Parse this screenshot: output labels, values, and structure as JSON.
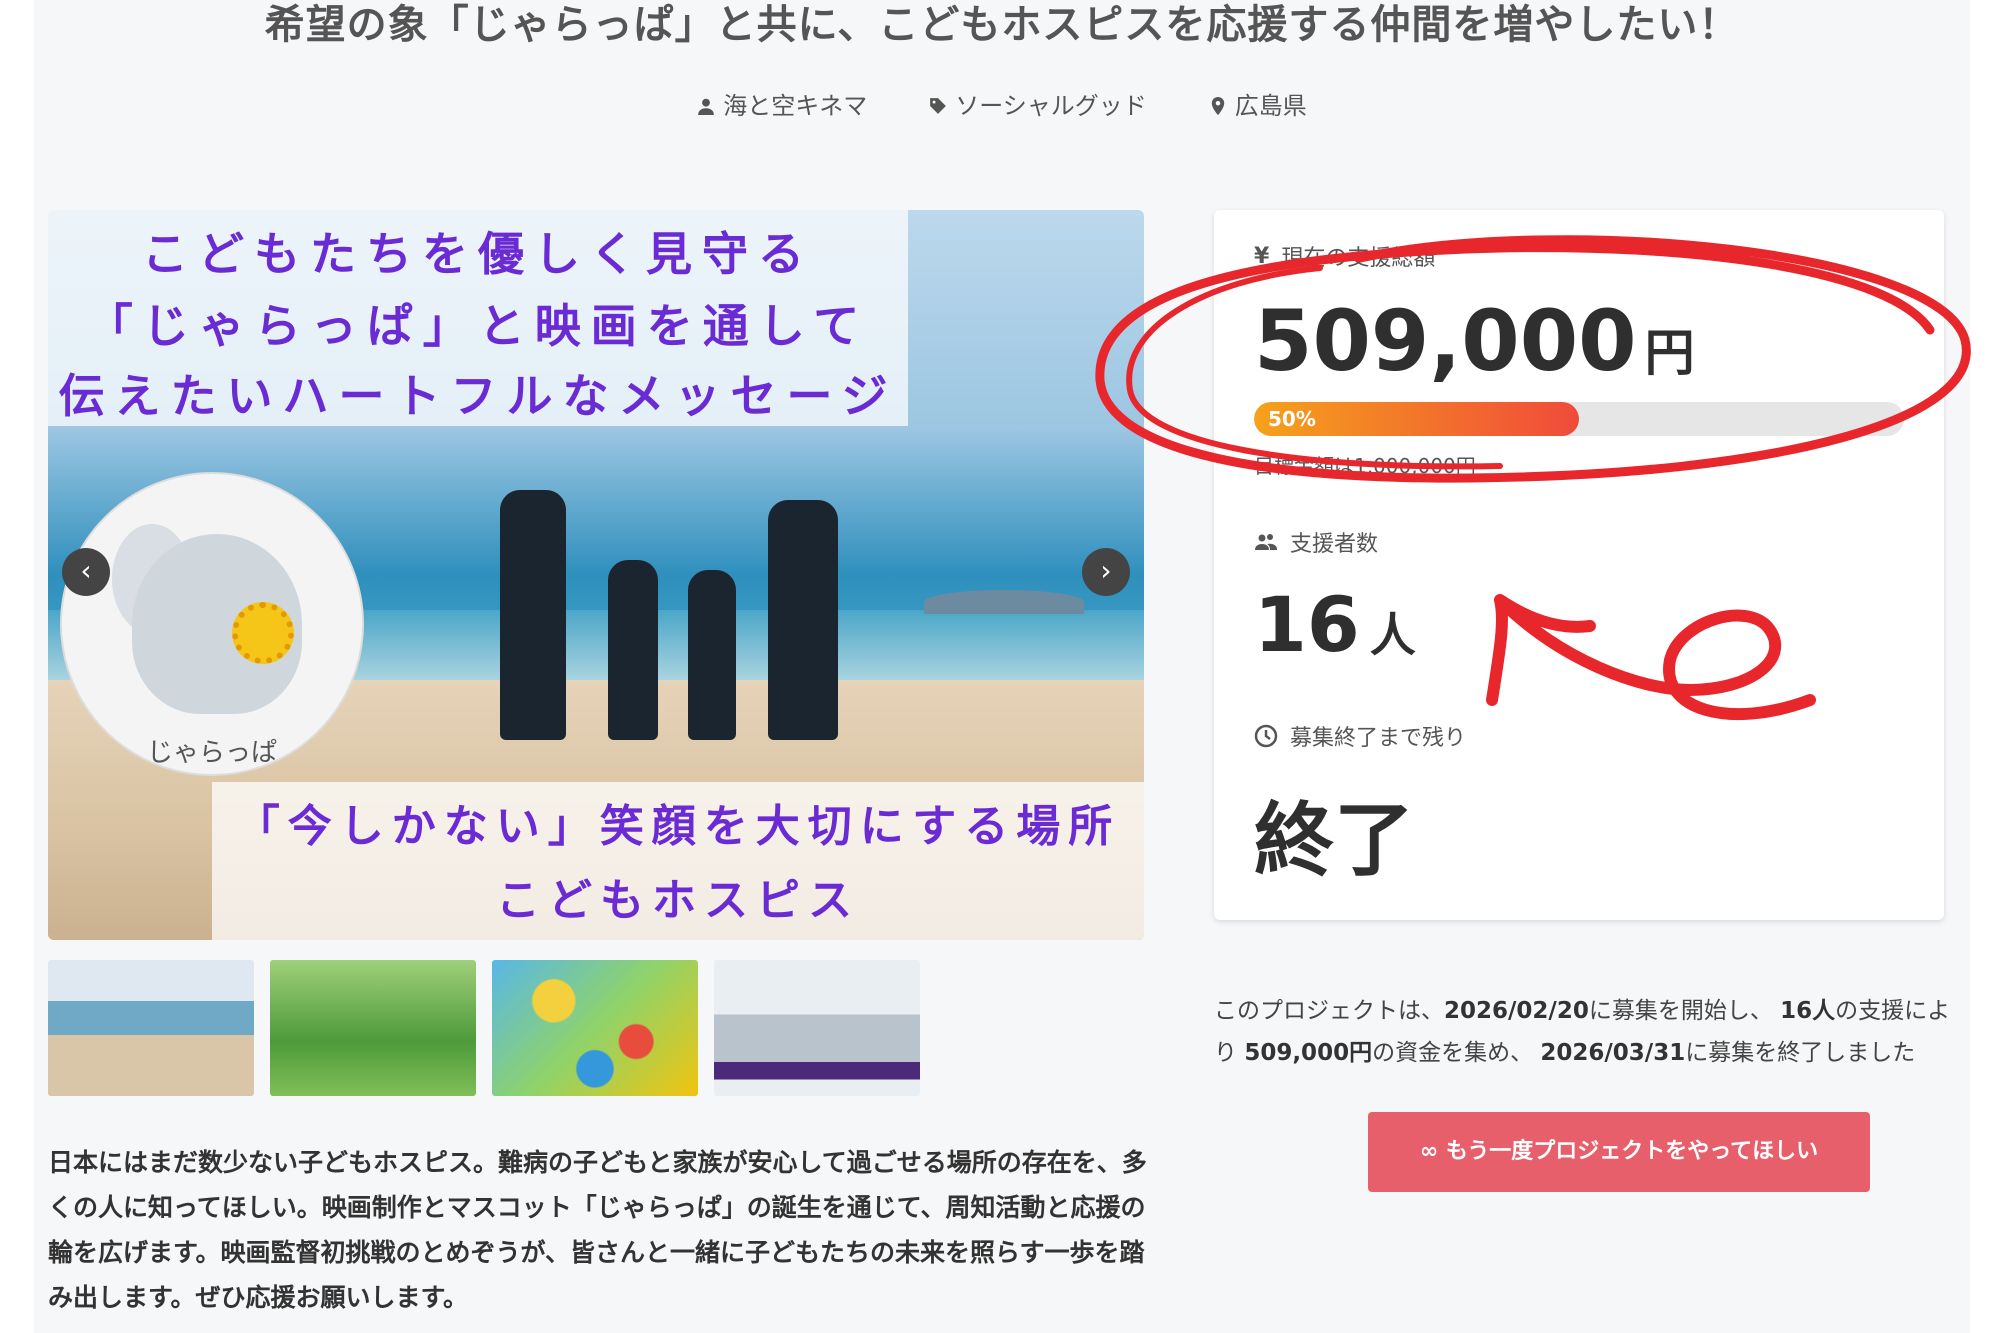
{
  "title": "希望の象「じゃらっぱ」と共に、こどもホスピスを応援する仲間を増やしたい！",
  "meta": {
    "author": "海と空キネマ",
    "category": "ソーシャルグッド",
    "location": "広島県"
  },
  "hero": {
    "lines_top": [
      "こどもたちを優しく見守る",
      "「じゃらっぱ」と映画を通して",
      "伝えたいハートフルなメッセージ"
    ],
    "lines_bottom": [
      "「今しかない」笑顔を大切にする場所",
      "こどもホスピス"
    ],
    "mascot_label": "じゃらっぱ",
    "prev": "‹",
    "next": "›"
  },
  "description": "日本にはまだ数少ない子どもホスピス。難病の子どもと家族が安心して過ごせる場所の存在を、多くの人に知ってほしい。映画制作とマスコット「じゃらっぱ」の誕生を通じて、周知活動と応援の輪を広げます。映画監督初挑戦のとめぞうが、皆さんと一緒に子どもたちの未来を照らす一歩を踏み出します。ぜひ応援お願いします。",
  "stats": {
    "amount_label": "現在の支援総額",
    "amount_value": "509,000",
    "amount_unit": "円",
    "progress_percent": 50,
    "progress_label": "50%",
    "target_text": "目標金額は1,000,000円",
    "backers_label": "支援者数",
    "backers_value": "16",
    "backers_unit": "人",
    "remaining_label": "募集終了まで残り",
    "remaining_value": "終了"
  },
  "summary": {
    "p1": "このプロジェクトは、",
    "start_date": "2026/02/20",
    "p2": "に募集を開始し、",
    "backers": "16人",
    "p3": "の支援により",
    "amount": "509,000円",
    "p4": "の資金を集め、",
    "end_date": "2026/03/31",
    "p5": "に募集を終了しました"
  },
  "cta_label": "∞ もう一度プロジェクトをやってほしい",
  "colors": {
    "accent": "#e85f6c",
    "hero_text": "#6a2ad4",
    "annotation": "#e8272d"
  }
}
